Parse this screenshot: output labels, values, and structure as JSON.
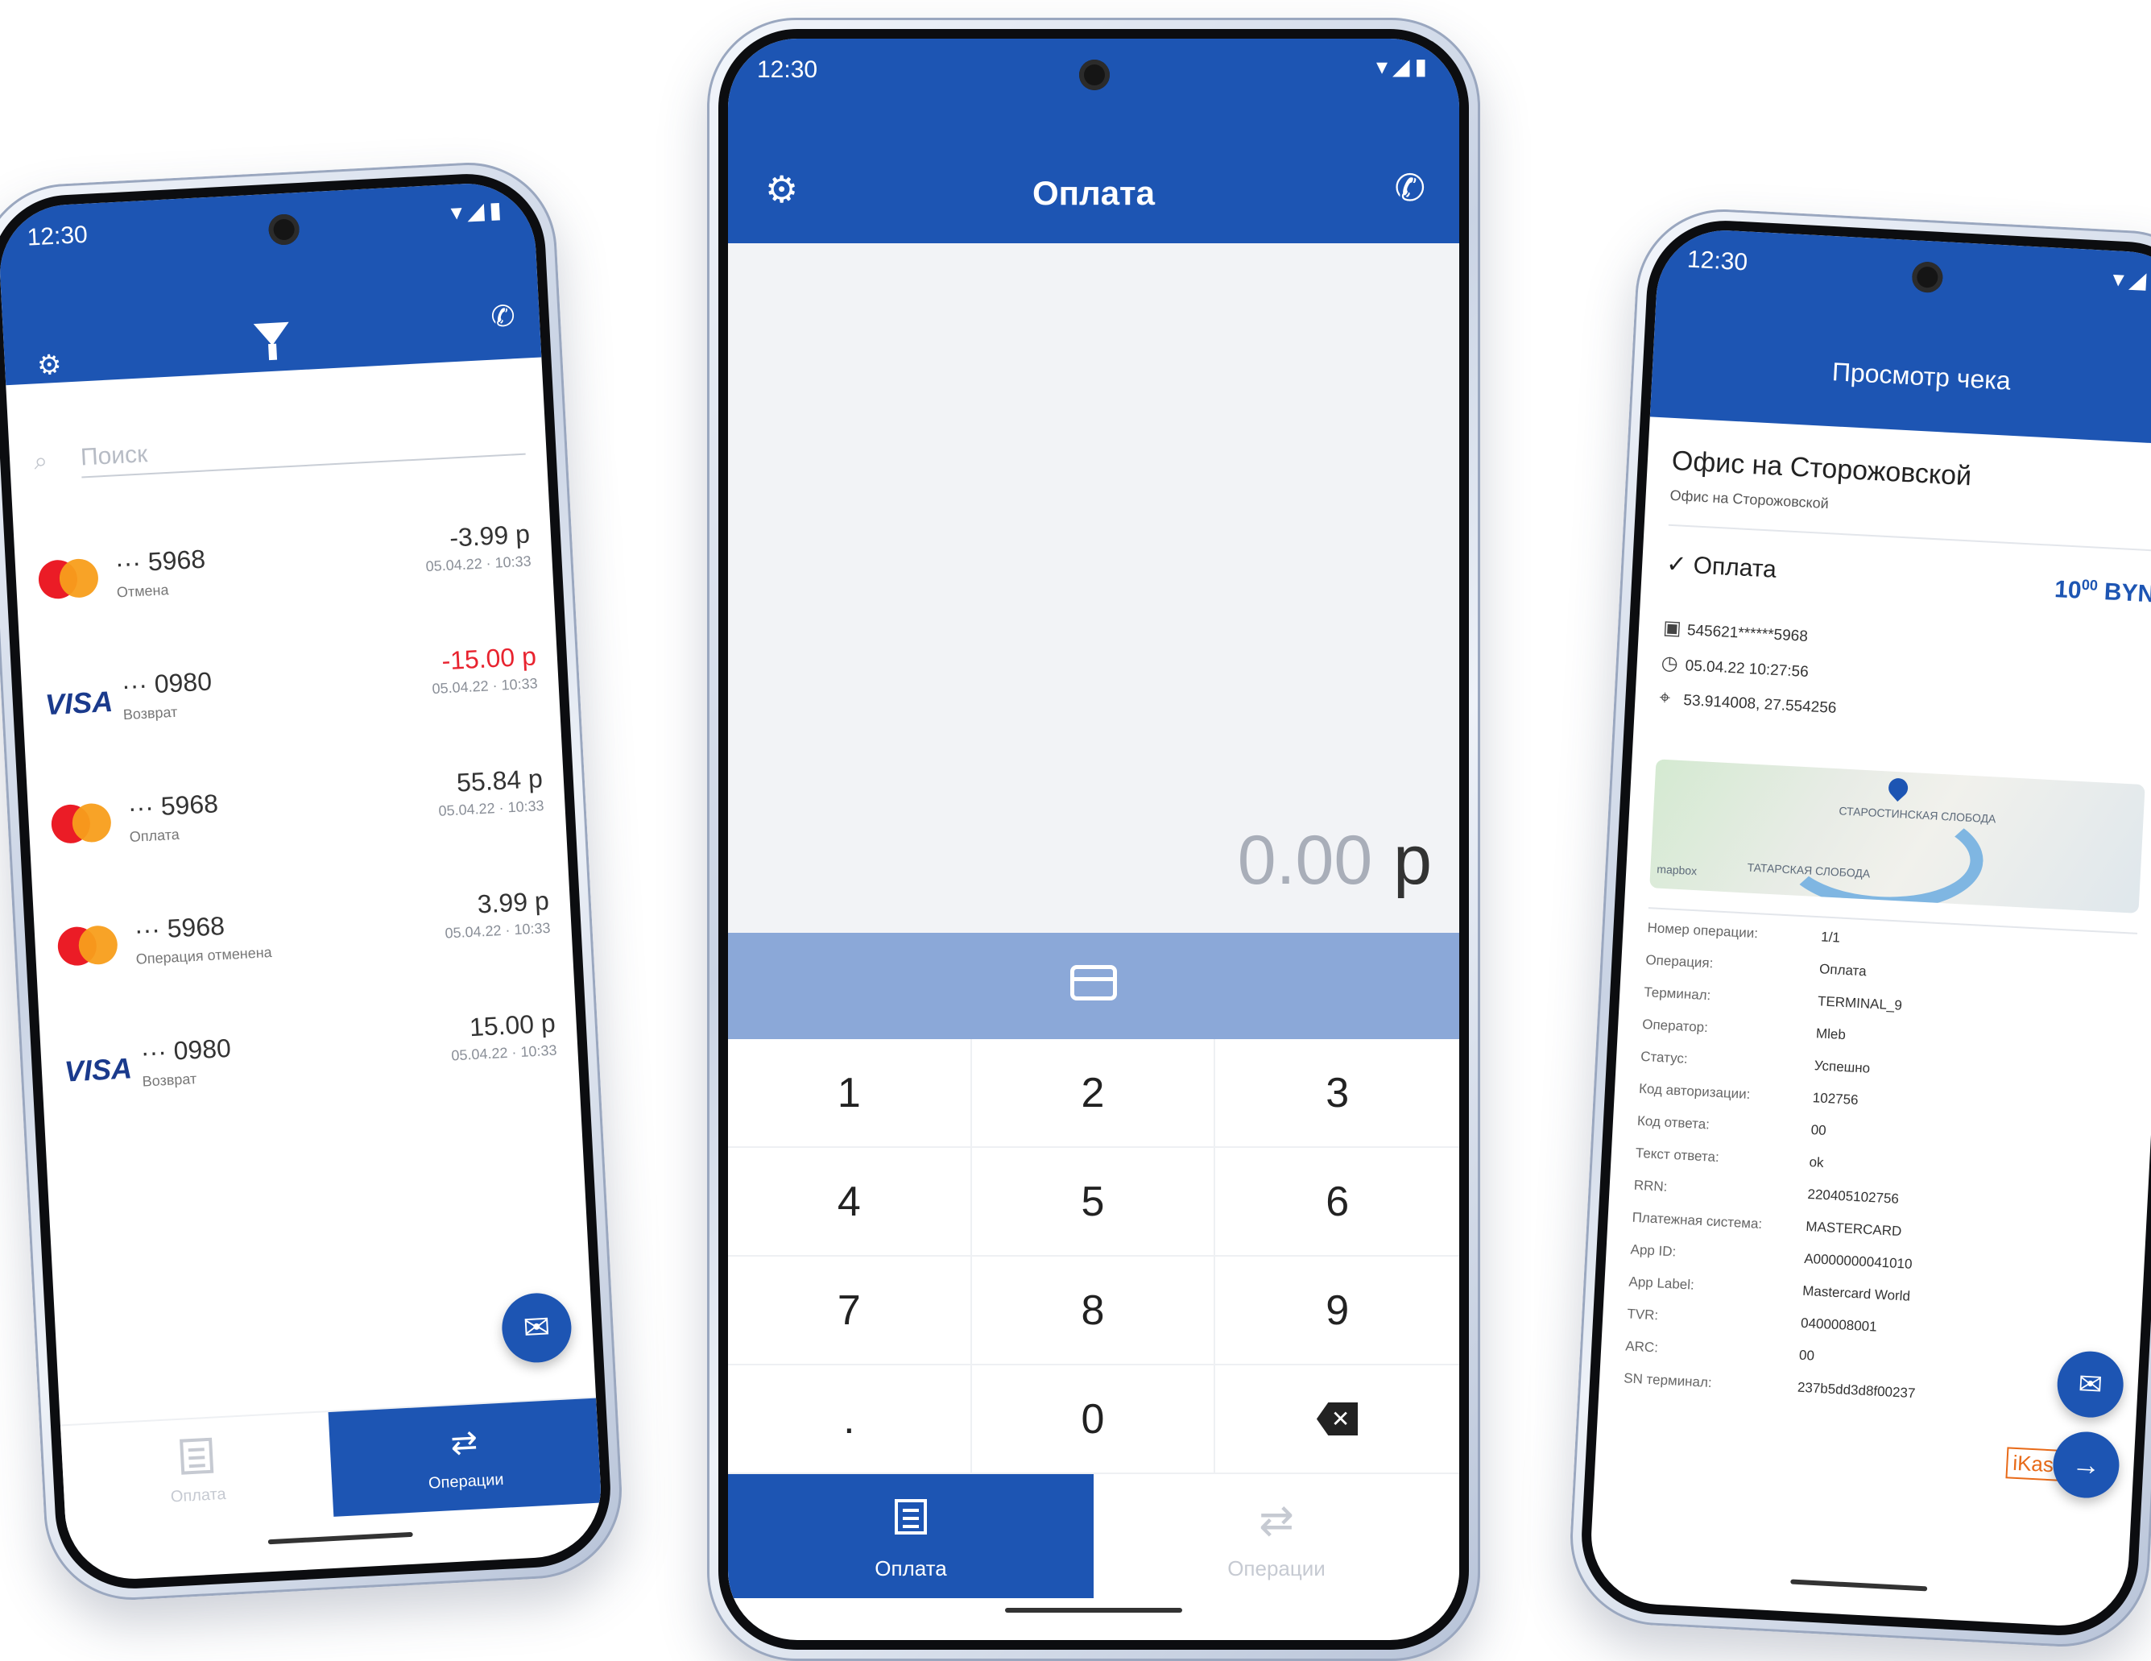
{
  "colors": {
    "primary": "#1d55b3",
    "card_strip": "#8ba8d8",
    "negative": "#e8232f",
    "brand_orange": "#e86a18"
  },
  "status": {
    "time": "12:30",
    "icons": "▾◢▮"
  },
  "payment_screen": {
    "title": "Оплата",
    "amount": "0.00",
    "currency": "р",
    "keys": [
      "1",
      "2",
      "3",
      "4",
      "5",
      "6",
      "7",
      "8",
      "9",
      ".",
      "0",
      "⌫"
    ],
    "nav": [
      {
        "label": "Оплата",
        "icon": "receipt-icon",
        "active": true
      },
      {
        "label": "Операции",
        "icon": "swap-arrows-icon",
        "active": false
      }
    ]
  },
  "operations_screen": {
    "search_placeholder": "Поиск",
    "transactions": [
      {
        "brand": "mastercard",
        "card": "··· 5968",
        "type": "Отмена",
        "amount": "-3.99 р",
        "date": "05.04.22 · 10:33",
        "negative": false
      },
      {
        "brand": "visa",
        "card": "··· 0980",
        "type": "Возврат",
        "amount": "-15.00 р",
        "date": "05.04.22 · 10:33",
        "negative": true
      },
      {
        "brand": "mastercard",
        "card": "··· 5968",
        "type": "Оплата",
        "amount": "55.84 р",
        "date": "05.04.22 · 10:33",
        "negative": false
      },
      {
        "brand": "mastercard",
        "card": "··· 5968",
        "type": "Операция отменена",
        "amount": "3.99 р",
        "date": "05.04.22 · 10:33",
        "negative": false
      },
      {
        "brand": "visa",
        "card": "··· 0980",
        "type": "Возврат",
        "amount": "15.00 р",
        "date": "05.04.22 · 10:33",
        "negative": false
      }
    ],
    "visa_text": "VISA",
    "nav": [
      {
        "label": "Оплата",
        "icon": "receipt-icon",
        "active": false
      },
      {
        "label": "Операции",
        "icon": "swap-arrows-icon",
        "active": true
      }
    ]
  },
  "receipt_screen": {
    "title": "Просмотр чека",
    "merchant": "Офис на Сторожовской",
    "merchant_sub": "Офис на Сторожовской",
    "operation": "Оплата",
    "amount_main": "10",
    "amount_sup": "00",
    "amount_currency": "BYN",
    "pan": "545621******5968",
    "datetime": "05.04.22  10:27:56",
    "coords": "53.914008, 27.554256",
    "map_labels": [
      "СТАРОСТИНСКАЯ СЛОБОДА",
      "ТАТАРСКАЯ СЛОБОДА",
      "mapbox"
    ],
    "details": [
      {
        "k": "Номер операции:",
        "v": "1/1"
      },
      {
        "k": "Операция:",
        "v": "Оплата"
      },
      {
        "k": "Терминал:",
        "v": "TERMINAL_9"
      },
      {
        "k": "Оператор:",
        "v": "Mleb"
      },
      {
        "k": "Статус:",
        "v": "Успешно"
      },
      {
        "k": "Код авторизации:",
        "v": "102756"
      },
      {
        "k": "Код ответа:",
        "v": "00"
      },
      {
        "k": "Текст ответа:",
        "v": "ok"
      },
      {
        "k": "RRN:",
        "v": "220405102756"
      },
      {
        "k": "Платежная система:",
        "v": "MASTERCARD"
      },
      {
        "k": "App ID:",
        "v": "A0000000041010"
      },
      {
        "k": "App Label:",
        "v": "Mastercard World"
      },
      {
        "k": "TVR:",
        "v": "0400008001"
      },
      {
        "k": "ARC:",
        "v": "00"
      },
      {
        "k": "SN терминал:",
        "v": "237b5dd3d8f00237"
      }
    ],
    "brand_logo": "iKassa"
  }
}
